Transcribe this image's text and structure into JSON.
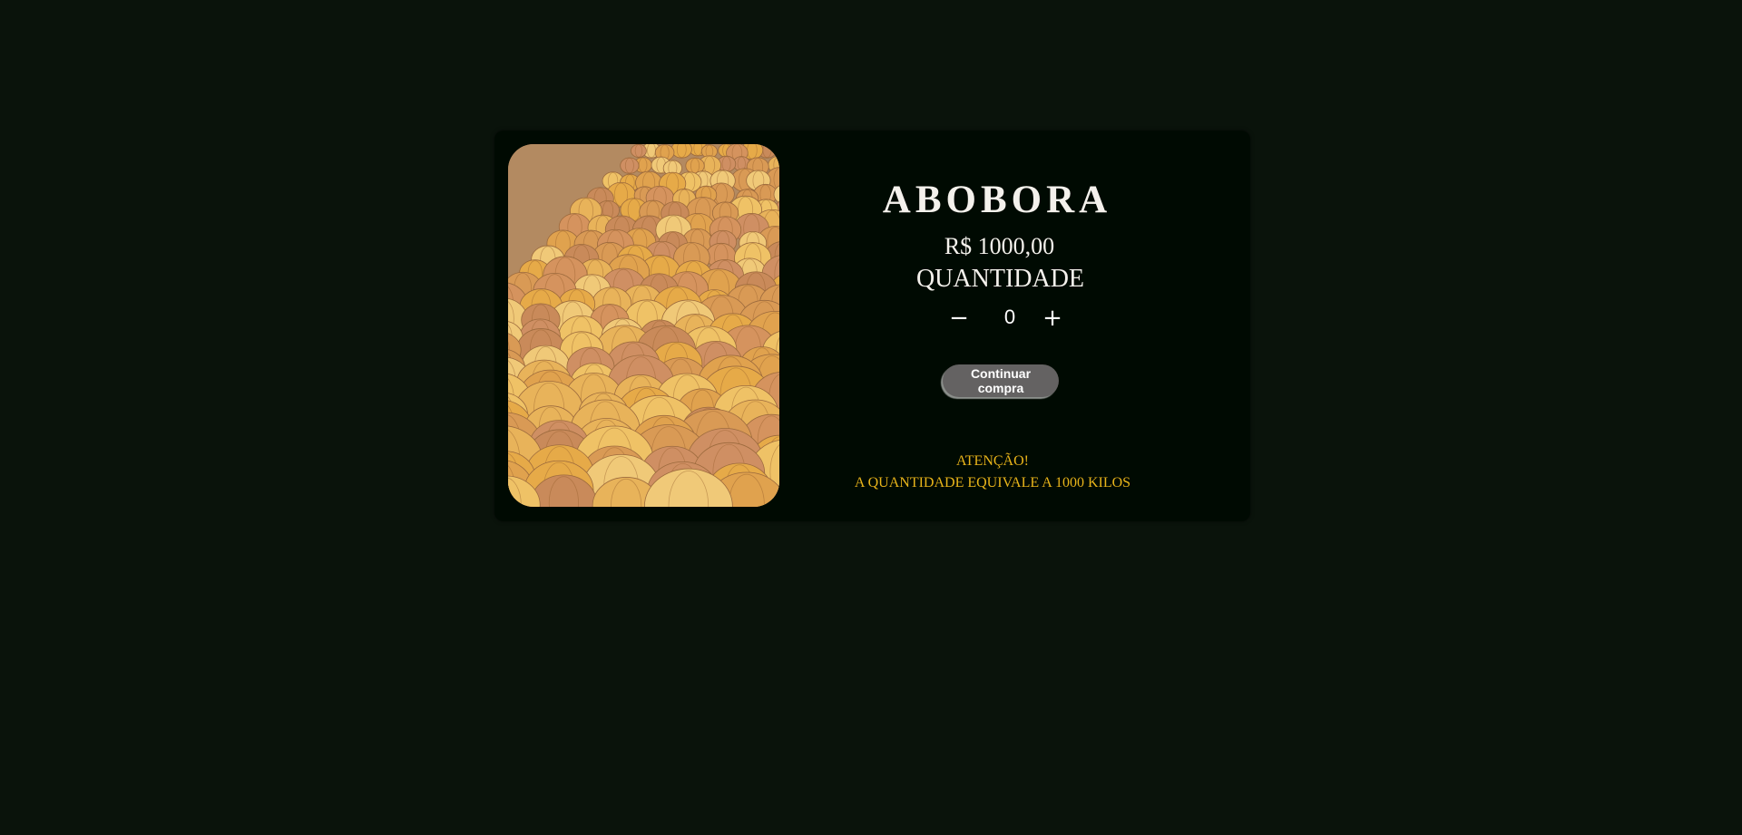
{
  "product": {
    "image_alt": "Abóboras",
    "title": "ABOBORA",
    "price": "R$ 1000,00",
    "quantity_label": "QUANTIDADE"
  },
  "stepper": {
    "minus_label": "−",
    "value": "0",
    "plus_label": "+"
  },
  "continue_button": {
    "label": "Continuar compra"
  },
  "notice": {
    "heading": "ATENÇÃO!",
    "text": "A QUANTIDADE EQUIVALE A 1000 KILOS"
  },
  "colors": {
    "page_background": "#0a130b",
    "card_background": "#000a02",
    "notice_text": "#e8b41a",
    "button_background": "#646262"
  }
}
